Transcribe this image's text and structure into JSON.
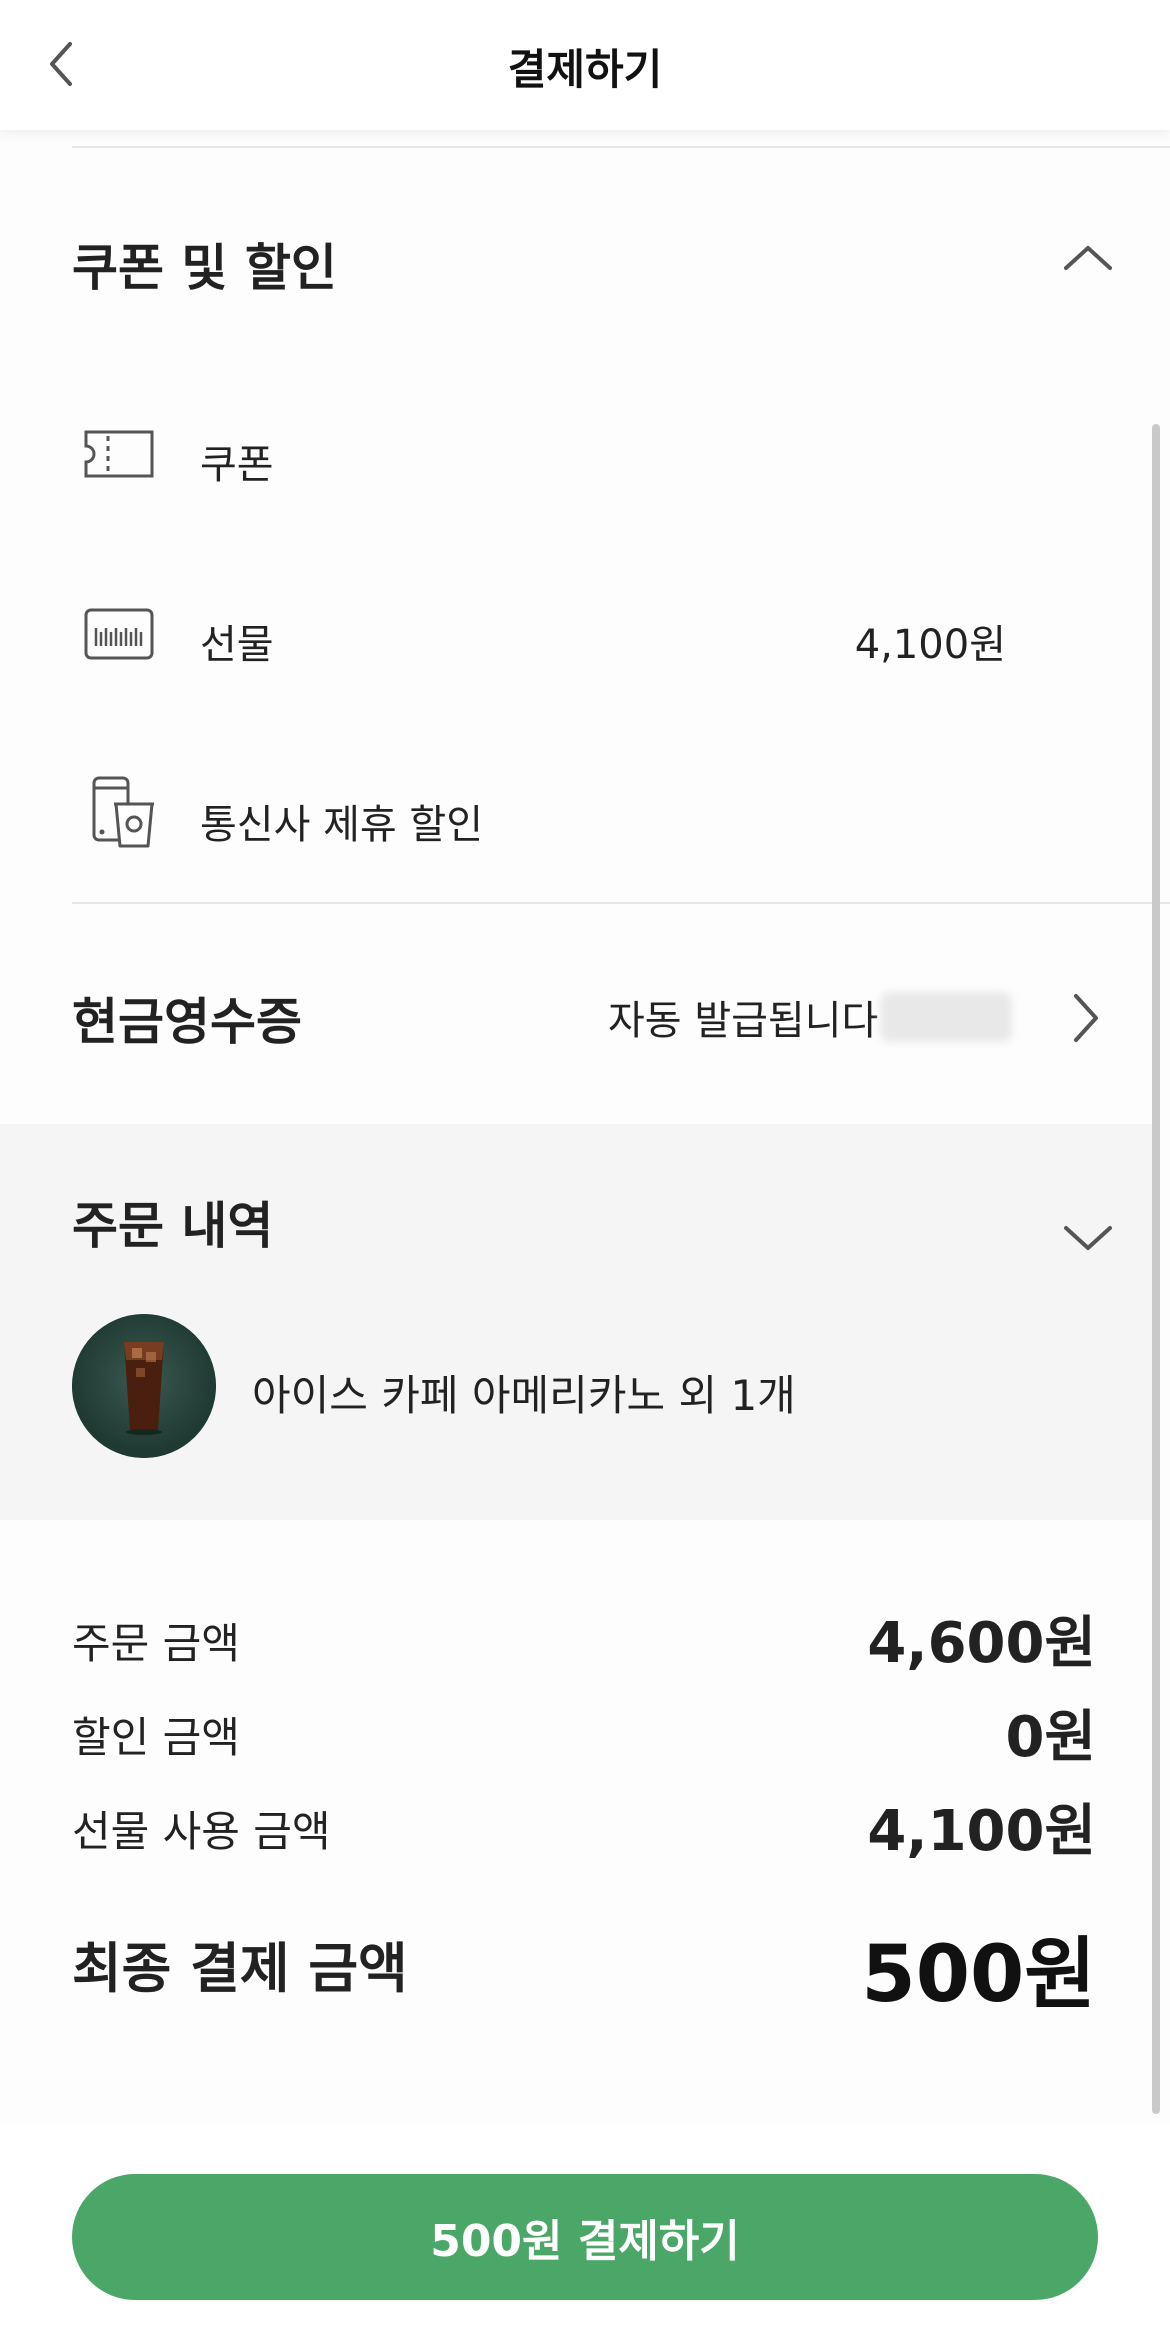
{
  "header": {
    "title": "결제하기",
    "back_icon": "chevron-left-icon"
  },
  "coupon_section": {
    "title": "쿠폰 및 할인",
    "toggle_icon": "chevron-up-icon",
    "items": [
      {
        "icon": "coupon-ticket-icon",
        "label": "쿠폰",
        "value": ""
      },
      {
        "icon": "gift-card-icon",
        "label": "선물",
        "value": "4,100원"
      },
      {
        "icon": "phone-cup-icon",
        "label": "통신사 제휴 할인",
        "value": ""
      }
    ]
  },
  "cash_receipt": {
    "label": "현금영수증",
    "value": "자동 발급됩니다",
    "arrow_icon": "chevron-right-icon"
  },
  "order_history": {
    "title": "주문 내역",
    "toggle_icon": "chevron-down-icon",
    "item": "아이스 카페 아메리카노 외 1개"
  },
  "summary": {
    "order_amount_label": "주문 금액",
    "order_amount": "4,600원",
    "discount_label": "할인 금액",
    "discount_amount": "0원",
    "gift_label": "선물 사용 금액",
    "gift_amount": "4,100원",
    "final_label": "최종 결제 금액",
    "final_amount": "500원"
  },
  "pay_button": {
    "label": "500원 결제하기"
  },
  "colors": {
    "accent": "#4ba768",
    "order_bg": "#f5f5f5",
    "thumb_bg": "#1f3a33"
  }
}
